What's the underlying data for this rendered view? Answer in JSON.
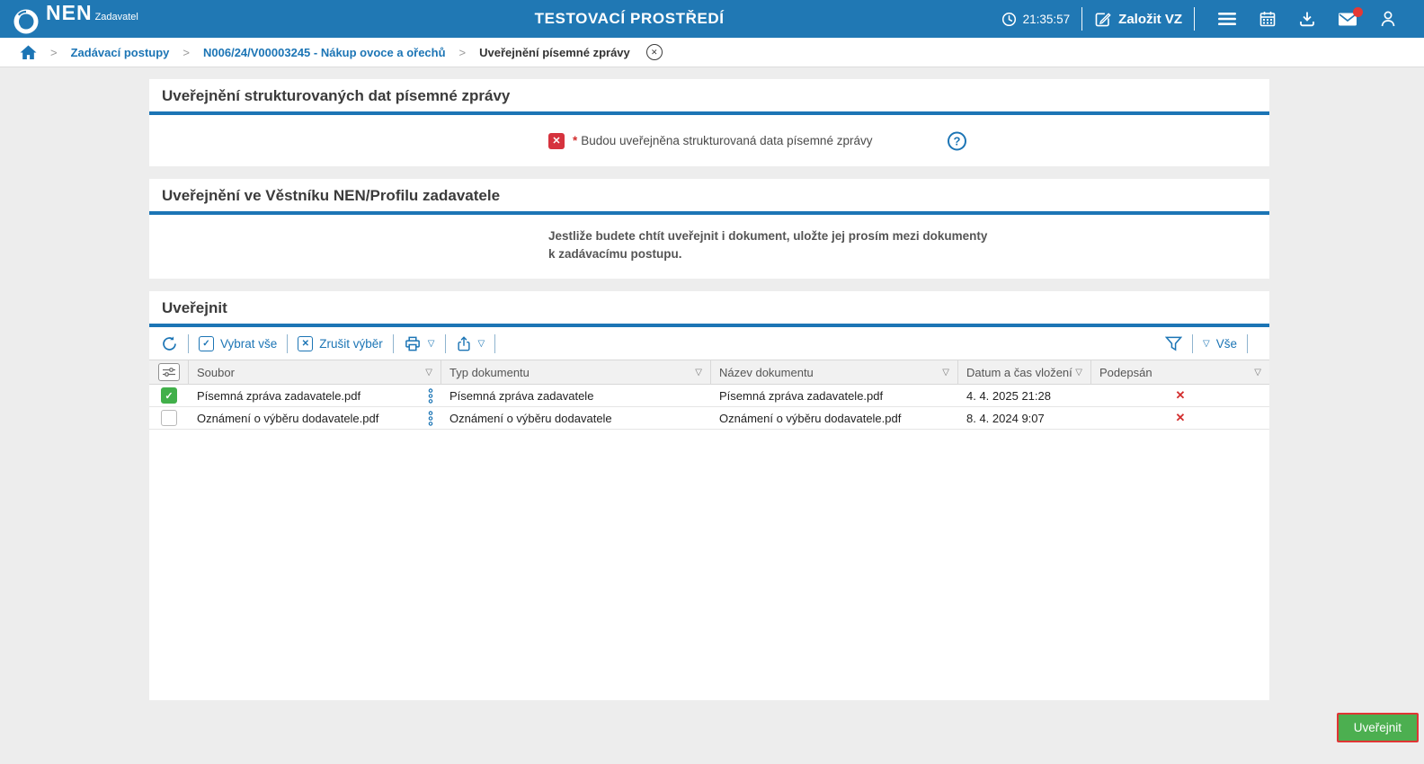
{
  "colors": {
    "header_blue": "#2078B4",
    "accent_blue": "#1C75B5",
    "green": "#4CAF50",
    "red": "#D32F2F",
    "page_bg": "#EDEDED"
  },
  "icons": {
    "check": "✓",
    "x_mark": "✕",
    "question": "?",
    "asterisk": "*",
    "sort_triangle": "▽",
    "dropdown_triangle": "▽",
    "breadcrumb_sep": ">"
  },
  "header": {
    "brand_name": "NEN",
    "brand_subtitle": "Zadavatel",
    "env_title": "TESTOVACÍ PROSTŘEDÍ",
    "time": "21:35:57",
    "create_vz_label": "Založit VZ"
  },
  "breadcrumb": {
    "items": [
      {
        "label": "Zadávací postupy"
      },
      {
        "label": "N006/24/V00003245 - Nákup ovoce a ořechů"
      },
      {
        "label": "Uveřejnění písemné zprávy"
      }
    ]
  },
  "section_structured": {
    "title": "Uveřejnění strukturovaných dat písemné zprávy",
    "field_label": "Budou uveřejněna strukturovaná data písemné zprávy"
  },
  "section_bulletin": {
    "title": "Uveřejnění ve Věstníku NEN/Profilu zadavatele",
    "note_line1": "Jestliže budete chtít uveřejnit i dokument, uložte jej prosím mezi dokumenty",
    "note_line2": "k zadávacímu postupu."
  },
  "section_publish": {
    "title": "Uveřejnit",
    "toolbar": {
      "select_all": "Vybrat vše",
      "clear_selection": "Zrušit výběr",
      "filter_scope": "Vše"
    },
    "table": {
      "columns": {
        "file": "Soubor",
        "type": "Typ dokumentu",
        "name": "Název dokumentu",
        "date": "Datum a čas vložení",
        "signed": "Podepsán"
      },
      "rows": [
        {
          "checked": true,
          "file": "Písemná zpráva zadavatele.pdf",
          "type": "Písemná zpráva zadavatele",
          "name": "Písemná zpráva zadavatele.pdf",
          "date": "4. 4. 2025 21:28",
          "signed": false
        },
        {
          "checked": false,
          "file": "Oznámení o výběru dodavatele.pdf",
          "type": "Oznámení o výběru dodavatele",
          "name": "Oznámení o výběru dodavatele.pdf",
          "date": "8. 4. 2024 9:07",
          "signed": false
        }
      ]
    }
  },
  "footer": {
    "publish_label": "Uveřejnit"
  }
}
